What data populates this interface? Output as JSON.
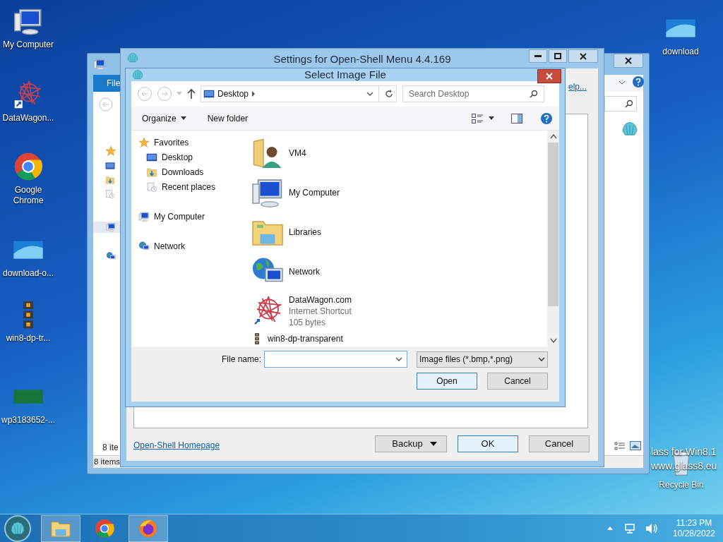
{
  "desktop_icons": [
    {
      "label": "My Computer",
      "kind": "computer"
    },
    {
      "label": "DataWagon...",
      "kind": "star-shortcut"
    },
    {
      "label": "Google Chrome",
      "kind": "chrome"
    },
    {
      "label": "download-o...",
      "kind": "picture"
    },
    {
      "label": "win8-dp-tr...",
      "kind": "stack"
    },
    {
      "label": "wp3183652-...",
      "kind": "green-picture"
    },
    {
      "label": "download",
      "kind": "picture"
    },
    {
      "label": "Recycle Bin",
      "kind": "bin"
    }
  ],
  "wallpaper_caption": [
    "lass for Win8.1",
    "www.glass8.eu"
  ],
  "explorer_window": {
    "ribbon_tab": "File",
    "item_count": "8 ite",
    "status_text": "8 items"
  },
  "settings_window": {
    "title": "Settings for Open-Shell Menu 4.4.169",
    "help_link": "elp...",
    "homepage_link": "Open-Shell Homepage",
    "buttons": [
      {
        "label": "Backup",
        "kind": "split",
        "default": false
      },
      {
        "label": "OK",
        "kind": "plain",
        "default": true
      },
      {
        "label": "Cancel",
        "kind": "plain",
        "default": false
      }
    ]
  },
  "dialog": {
    "title": "Select Image File",
    "address": "Desktop",
    "search": {
      "placeholder": "Search Desktop"
    },
    "toolbar": [
      {
        "label": "Organize",
        "has_menu": true
      },
      {
        "label": "New folder",
        "has_menu": false
      }
    ],
    "nav_pane": [
      {
        "label": "Favorites",
        "kind": "star",
        "children": [
          {
            "label": "Desktop",
            "kind": "desktop"
          },
          {
            "label": "Downloads",
            "kind": "downloads"
          },
          {
            "label": "Recent places",
            "kind": "recent"
          }
        ]
      },
      {
        "label": "My Computer",
        "kind": "computer"
      },
      {
        "label": "Network",
        "kind": "network"
      }
    ],
    "files": [
      {
        "name": "VM4",
        "kind": "user-folder"
      },
      {
        "name": "My Computer",
        "kind": "computer"
      },
      {
        "name": "Libraries",
        "kind": "libraries"
      },
      {
        "name": "Network",
        "kind": "network"
      },
      {
        "name": "DataWagon.com",
        "kind": "star-shortcut",
        "details": [
          "Internet Shortcut",
          "105 bytes"
        ]
      },
      {
        "name": "win8-dp-transparent",
        "kind": "stack"
      }
    ],
    "file_name_label": "File name:",
    "filter": "Image files (*.bmp,*.png)",
    "buttons": [
      {
        "label": "Open",
        "default": true
      },
      {
        "label": "Cancel",
        "default": false
      }
    ]
  },
  "taskbar": {
    "apps": [
      {
        "kind": "explorer",
        "active": true
      },
      {
        "kind": "chrome",
        "active": false
      },
      {
        "kind": "firefox",
        "active": true
      }
    ],
    "time": "11:23 PM",
    "date": "10/28/2022"
  }
}
